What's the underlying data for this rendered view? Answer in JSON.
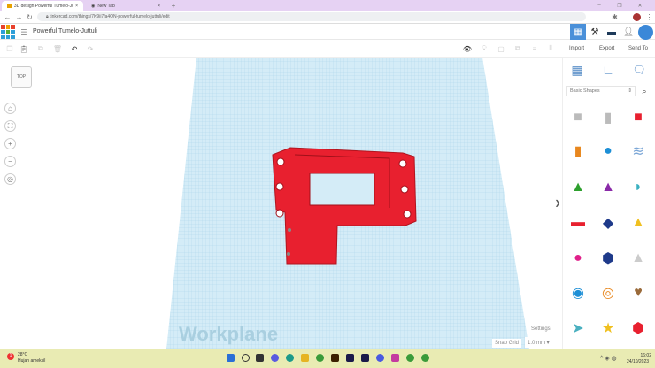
{
  "browser": {
    "tabs": [
      {
        "label": "3D design Powerful Tumelo-Jutt..."
      },
      {
        "label": "New Tab"
      }
    ],
    "url": "tinkercad.com/things/7K9ii7fa4ON-powerful-tumelo-juttuli/edit"
  },
  "app": {
    "logo_letters": [
      "TIN",
      "KER",
      "CAD"
    ],
    "design_title": "Powerful Tumelo-Juttuli",
    "actions": {
      "import": "Import",
      "export": "Export",
      "send_to": "Send To"
    },
    "view_cube": "TOP",
    "workplane_label": "Workplane",
    "settings_label": "Settings",
    "snap_grid_label": "Snap Grid",
    "snap_grid_value": "1.0 mm",
    "shapes_category": "Basic Shapes",
    "colors": {
      "shape_red": "#e8202f",
      "workplane": "#cfe9f5",
      "accent": "#4a90d9"
    }
  },
  "taskbar": {
    "weather_temp": "28°C",
    "weather_text": "Hujan ameksil",
    "time": "16:02",
    "date": "24/10/2023",
    "notification_count": "1"
  }
}
